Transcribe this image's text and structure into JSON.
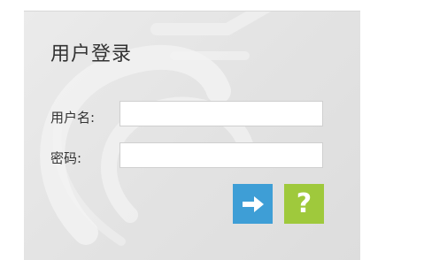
{
  "login": {
    "title": "用户登录",
    "username_label": "用户名:",
    "username_value": "",
    "password_label": "密码:",
    "password_value": ""
  },
  "buttons": {
    "login_icon": "arrow-right-icon",
    "help_icon": "question-mark-icon",
    "help_glyph": "?"
  },
  "colors": {
    "login_button": "#3e9ed6",
    "help_button": "#9fc93c",
    "panel_background": "#e6e6e6"
  }
}
